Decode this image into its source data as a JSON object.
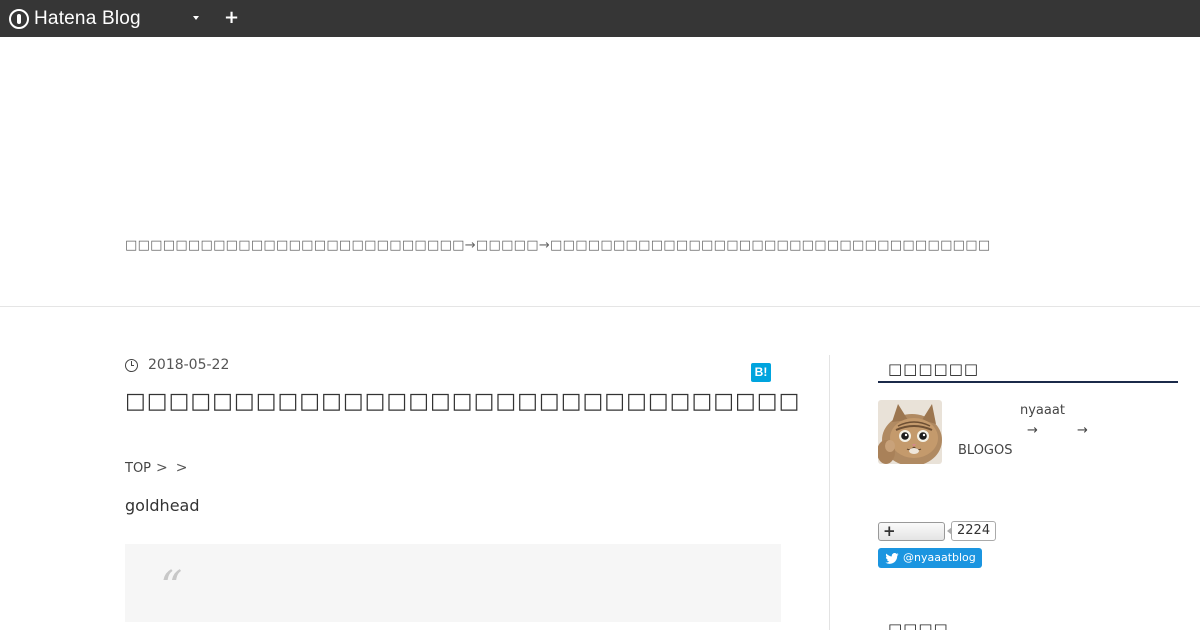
{
  "globalbar": {
    "logo_text": "Hatena Blog",
    "caret_icon": "chevron-down-icon",
    "plus_icon": "plus-icon",
    "background": "#363636"
  },
  "header": {
    "description": "□□□□□□□□□□□□□□□□□□□□□□□□□□□→□□□□□→□□□□□□□□□□□□□□□□□□□□□□□□□□□□□□□□□□□"
  },
  "entry": {
    "date": "2018-05-22",
    "bookmark_label": "B!",
    "title": "□□□□□□□□□□□□□□□□□□□□□□□□□□□□□□□",
    "breadcrumb": {
      "top_label": "TOP",
      "sep1": ">",
      "sep2": ">"
    },
    "text": "goldhead",
    "quote_mark": "“"
  },
  "sidebar": {
    "profile_heading": "□□□□□□",
    "profile": {
      "name": "nyaaat",
      "arrow1": "→",
      "arrow2": "→",
      "blogos": "BLOGOS"
    },
    "reader_count": "2224",
    "twitter_label": "@nyaaatblog",
    "twitter_color": "#1b95e0",
    "second_heading": "□□□□"
  },
  "accent": {
    "hatebu": "#00a4de",
    "heading_rule": "#1b2a4a"
  }
}
